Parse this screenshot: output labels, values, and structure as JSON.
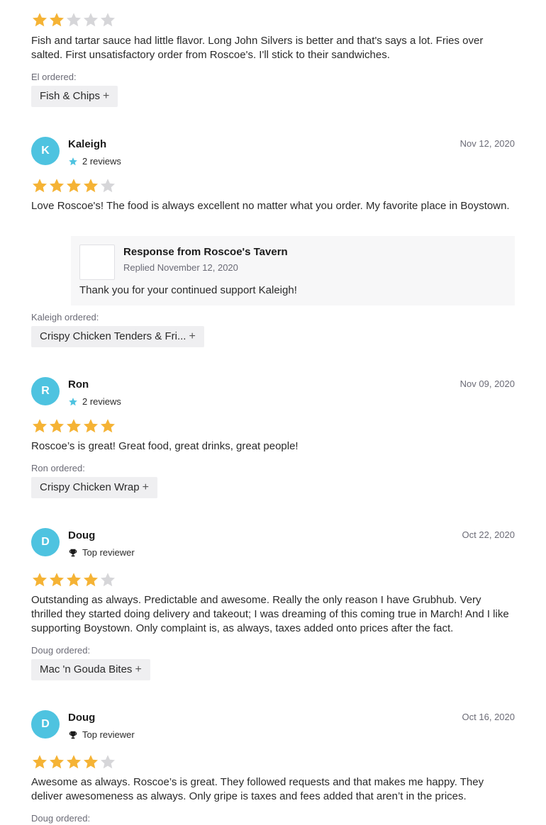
{
  "colors": {
    "star_filled": "#f5b335",
    "star_empty": "#d6d6d9",
    "avatar_bg": "#4ec3e0",
    "reviews_star": "#4ec3e0"
  },
  "reviews": [
    {
      "rating": 2,
      "text": "Fish and tartar sauce had little flavor. Long John Silvers is better and that's says a lot. Fries over salted. First unsatisfactory order from Roscoe's. I'll stick to their sandwiches.",
      "ordered_label": "El ordered:",
      "item": "Fish & Chips"
    },
    {
      "initial": "K",
      "name": "Kaleigh",
      "meta": "2 reviews",
      "meta_icon": "star-icon",
      "date": "Nov 12, 2020",
      "rating": 4,
      "text": "Love Roscoe's! The food is always excellent no matter what you order. My favorite place in Boystown.",
      "response": {
        "title": "Response from Roscoe's Tavern",
        "replied": "Replied November 12, 2020",
        "text": "Thank you for your continued support Kaleigh!"
      },
      "ordered_label": "Kaleigh ordered:",
      "item": "Crispy Chicken Tenders & Fri..."
    },
    {
      "initial": "R",
      "name": "Ron",
      "meta": "2 reviews",
      "meta_icon": "star-icon",
      "date": "Nov 09, 2020",
      "rating": 5,
      "text": "Roscoe’s is great! Great food, great drinks, great people!",
      "ordered_label": "Ron ordered:",
      "item": "Crispy Chicken Wrap"
    },
    {
      "initial": "D",
      "name": "Doug",
      "meta": "Top reviewer",
      "meta_icon": "trophy-icon",
      "date": "Oct 22, 2020",
      "rating": 4,
      "text": "Outstanding as always. Predictable and awesome. Really the only reason I have Grubhub. Very thrilled they started doing delivery and takeout; I was dreaming of this coming true in March! And I like supporting Boystown. Only complaint is, as always, taxes added onto prices after the fact.",
      "ordered_label": "Doug ordered:",
      "item": "Mac 'n Gouda Bites"
    },
    {
      "initial": "D",
      "name": "Doug",
      "meta": "Top reviewer",
      "meta_icon": "trophy-icon",
      "date": "Oct 16, 2020",
      "rating": 4,
      "text": "Awesome as always. Roscoe’s is great. They followed requests and that makes me happy. They deliver awesomeness as always. Only gripe is taxes and fees added that aren’t in the prices.",
      "ordered_label": "Doug ordered:"
    }
  ]
}
